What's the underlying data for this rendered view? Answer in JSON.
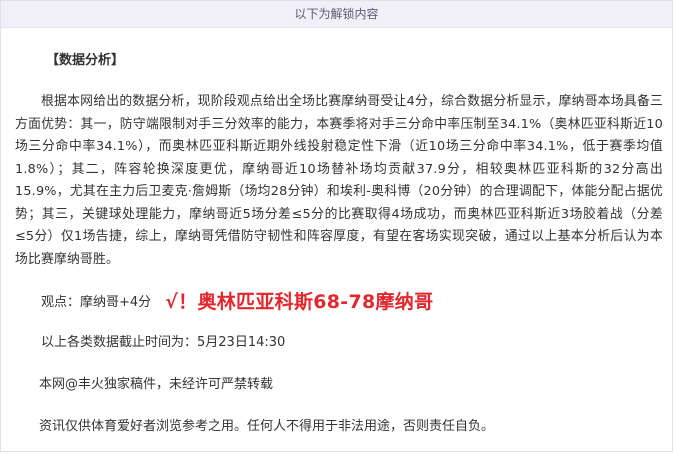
{
  "banner": {
    "text": "以下为解锁内容"
  },
  "article": {
    "heading": "【数据分析】",
    "body": "根据本网给出的数据分析，现阶段观点给出全场比赛摩纳哥受让4分，综合数据分析显示，摩纳哥本场具备三方面优势：其一，防守端限制对手三分效率的能力，本赛季将对手三分命中率压制至34.1%（奥林匹亚科斯近10场三分命中率34.1%），而奥林匹亚科斯近期外线投射稳定性下滑（近10场三分命中率34.1%，低于赛季均值1.8%）；其二，阵容轮换深度更优，摩纳哥近10场替补场均贡献37.9分，相较奥林匹亚科斯的32分高出15.9%，尤其在主力后卫麦克·詹姆斯（场均28分钟）和埃利-奥科博（20分钟）的合理调配下，体能分配占据优势；其三，关键球处理能力，摩纳哥近5场分差≤5分的比赛取得4场成功，而奥林匹亚科斯近3场胶着战（分差≤5分）仅1场告捷，综上，摩纳哥凭借防守韧性和阵容厚度，有望在客场实现突破，通过以上基本分析后认为本场比赛摩纳哥胜。",
    "verdict_label": "观点：摩纳哥+4分",
    "verdict_result": "√！奥林匹亚科斯68-78摩纳哥",
    "data_time": "以上各类数据截止时间为：5月23日14:30",
    "copyright": "本网@丰火独家稿件，未经许可严禁转载",
    "disclaimer": "资讯仅供体育爱好者浏览参考之用。任何人不得用于非法用途，否则责任自负。"
  },
  "colors": {
    "banner_bg": "#f1eff8",
    "result_red": "#e4262d",
    "text": "#333333"
  }
}
